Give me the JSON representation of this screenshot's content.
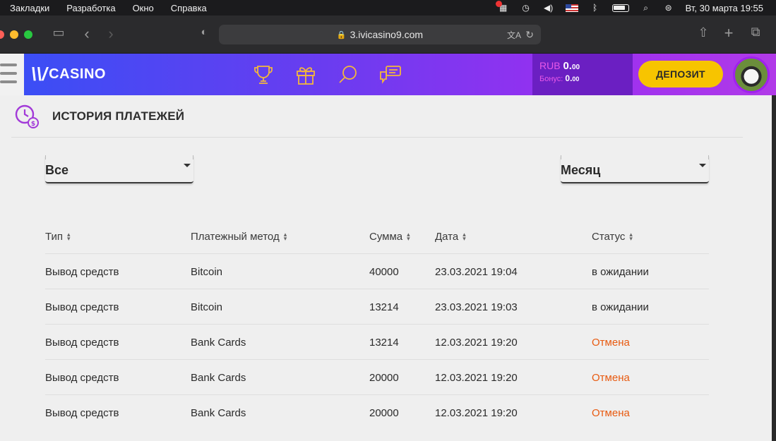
{
  "menubar": {
    "items": [
      "Закладки",
      "Разработка",
      "Окно",
      "Справка"
    ],
    "clock": "Вт, 30 марта  19:55"
  },
  "browser": {
    "url": "3.ivicasino9.com"
  },
  "header": {
    "logo_text": "CASINO",
    "balance_currency": "RUB",
    "balance_amount": "0.",
    "balance_cents": "00",
    "bonus_label": "Бонус:",
    "bonus_amount": "0.",
    "bonus_cents": "00",
    "deposit_label": "ДЕПОЗИТ"
  },
  "page": {
    "title": "ИСТОРИЯ ПЛАТЕЖЕЙ",
    "filter_type": "Все",
    "filter_period": "Месяц"
  },
  "table": {
    "headers": [
      "Тип",
      "Платежный метод",
      "Сумма",
      "Дата",
      "Статус"
    ],
    "rows": [
      {
        "type": "Вывод средств",
        "method": "Bitcoin",
        "amount": "40000",
        "date": "23.03.2021 19:04",
        "status": "в ожидании"
      },
      {
        "type": "Вывод средств",
        "method": "Bitcoin",
        "amount": "13214",
        "date": "23.03.2021 19:03",
        "status": "в ожидании"
      },
      {
        "type": "Вывод средств",
        "method": "Bank Cards",
        "amount": "13214",
        "date": "12.03.2021 19:20",
        "status": "Отмена"
      },
      {
        "type": "Вывод средств",
        "method": "Bank Cards",
        "amount": "20000",
        "date": "12.03.2021 19:20",
        "status": "Отмена"
      },
      {
        "type": "Вывод средств",
        "method": "Bank Cards",
        "amount": "20000",
        "date": "12.03.2021 19:20",
        "status": "Отмена"
      }
    ]
  },
  "colors": {
    "accent_yellow": "#f7c400",
    "cancel_orange": "#e85a10",
    "header_purple": "#9b2ff0"
  }
}
